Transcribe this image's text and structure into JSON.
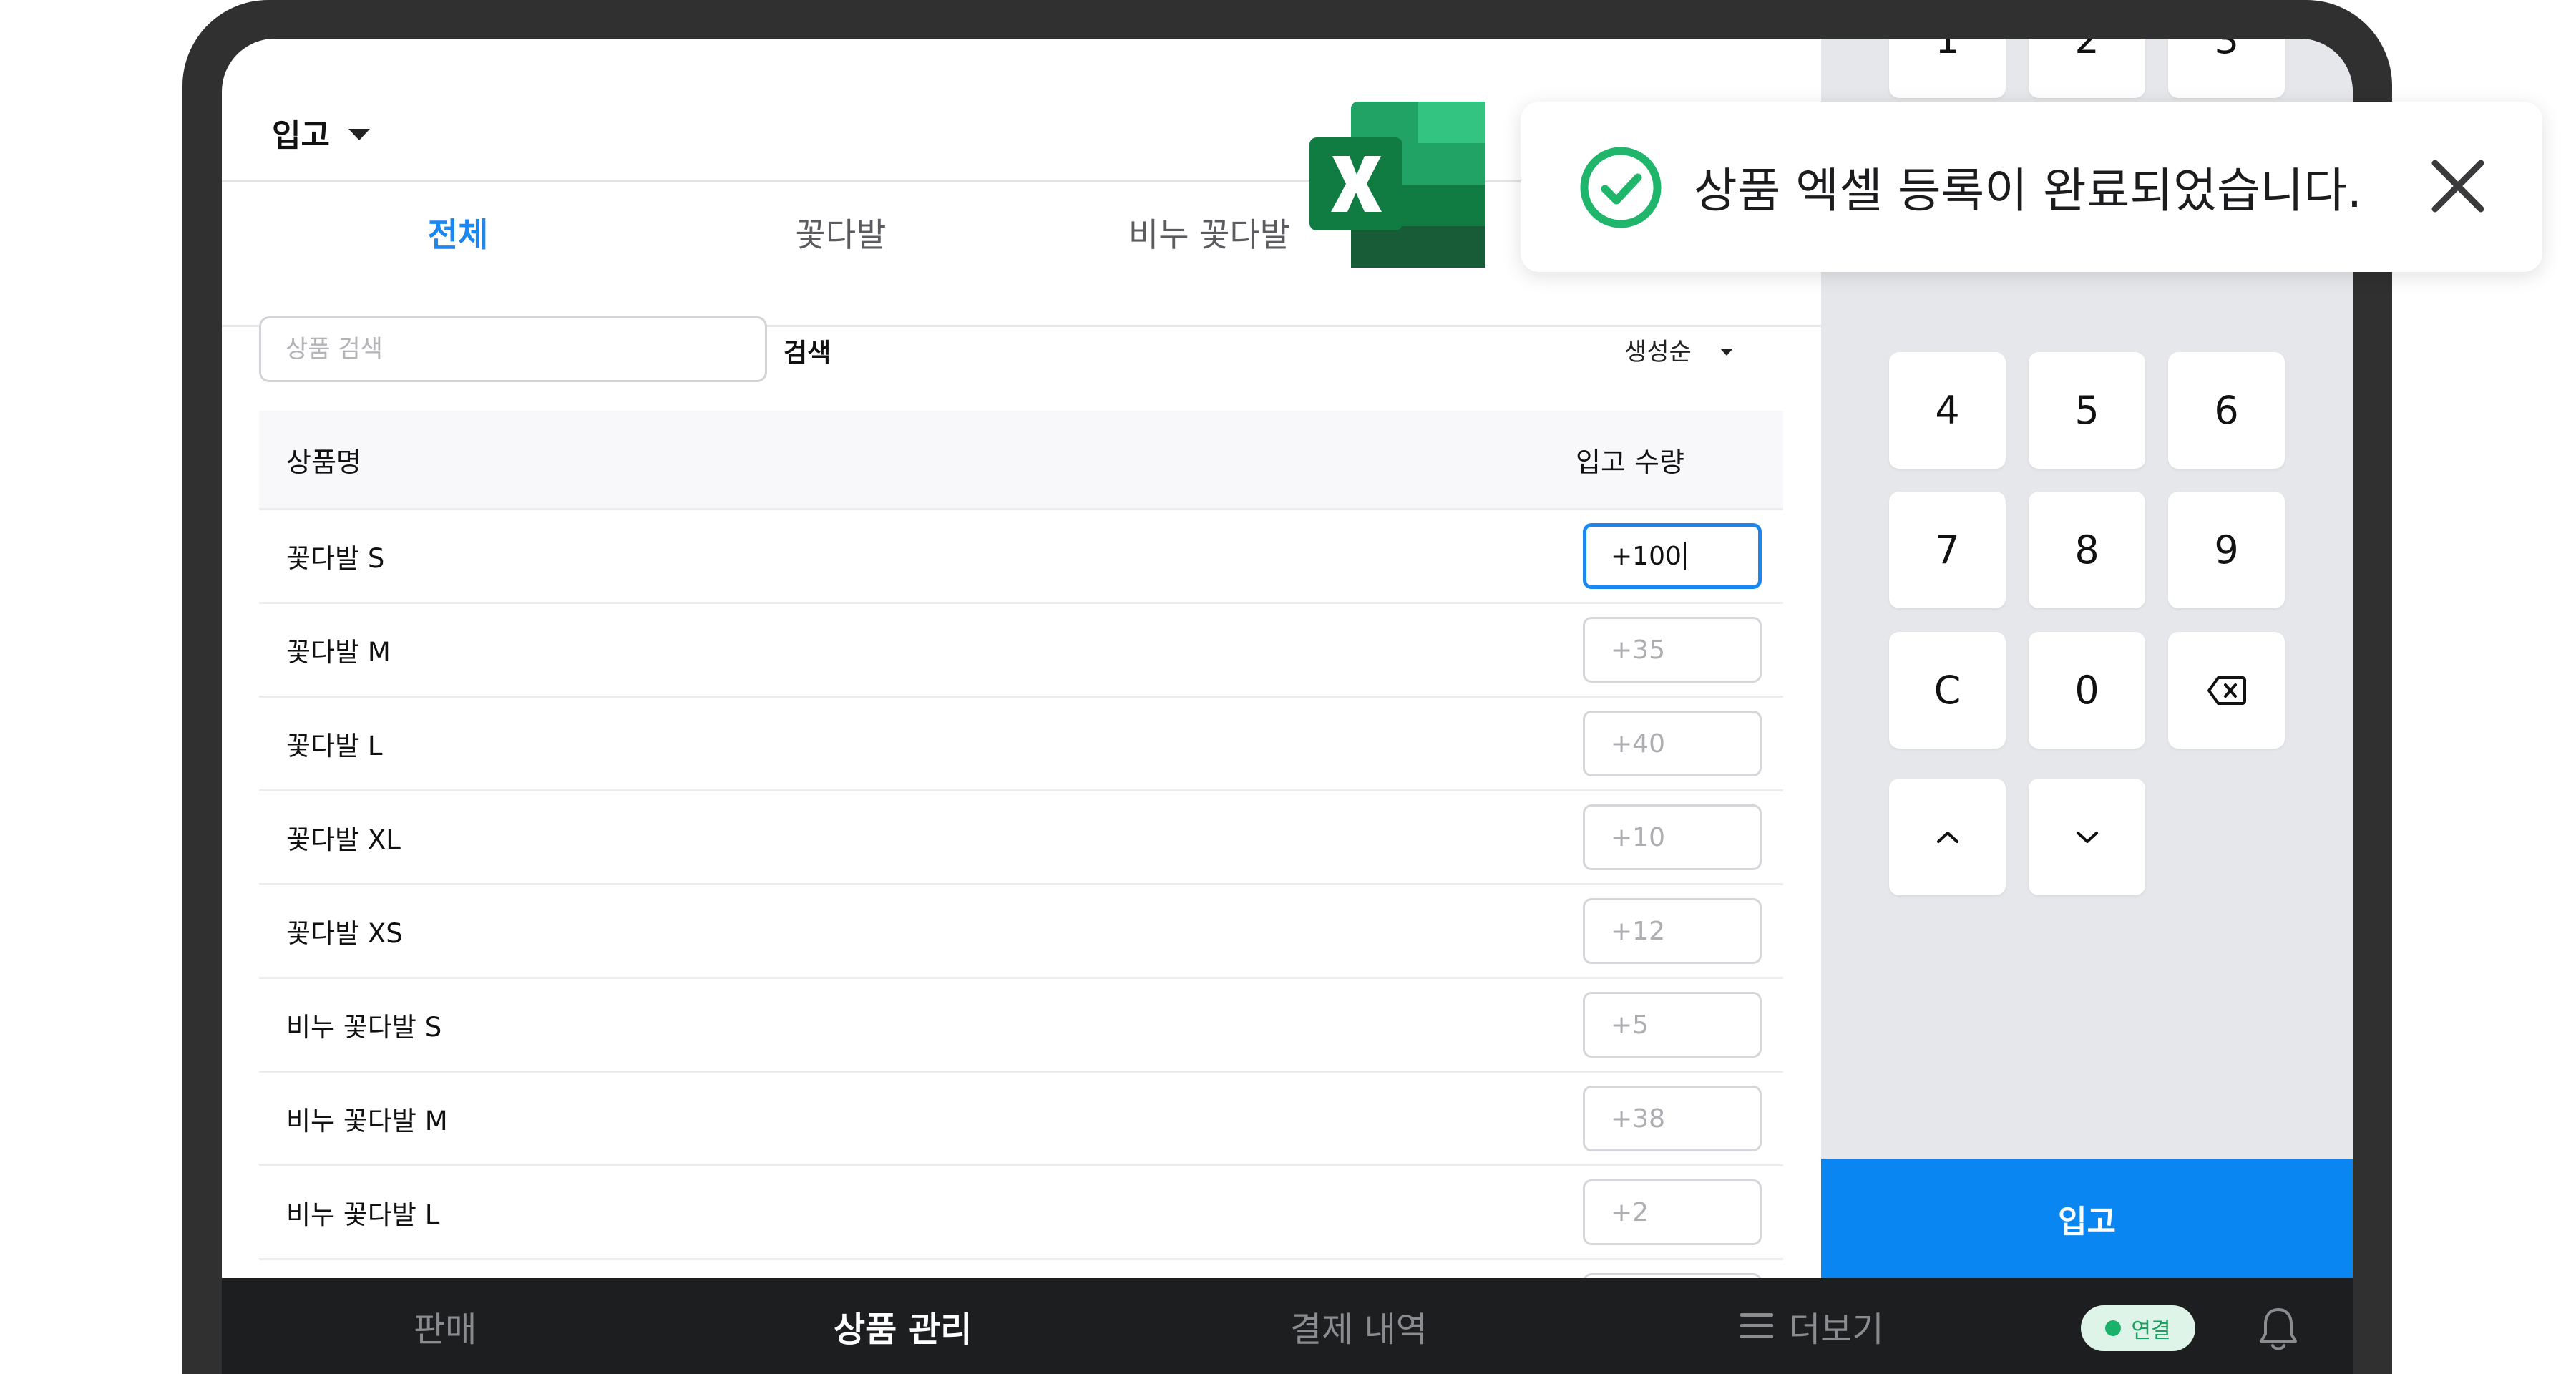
{
  "header": {
    "mode_label": "입고"
  },
  "tabs": [
    {
      "label": "전체",
      "active": true
    },
    {
      "label": "꽃다발",
      "active": false
    },
    {
      "label": "비누 꽃다발",
      "active": false
    }
  ],
  "search": {
    "placeholder": "상품 검색",
    "button_label": "검색",
    "sort_label": "생성순"
  },
  "table": {
    "headers": {
      "name": "상품명",
      "qty": "입고 수량"
    },
    "rows": [
      {
        "name": "꽃다발 S",
        "qty": "+100",
        "active": true
      },
      {
        "name": "꽃다발 M",
        "qty": "+35"
      },
      {
        "name": "꽃다발 L",
        "qty": "+40"
      },
      {
        "name": "꽃다발 XL",
        "qty": "+10"
      },
      {
        "name": "꽃다발 XS",
        "qty": "+12"
      },
      {
        "name": "비누 꽃다발 S",
        "qty": "+5"
      },
      {
        "name": "비누 꽃다발 M",
        "qty": "+38"
      },
      {
        "name": "비누 꽃다발 L",
        "qty": "+2"
      }
    ]
  },
  "keypad": {
    "keys": [
      "1",
      "2",
      "3",
      "4",
      "5",
      "6",
      "7",
      "8",
      "9",
      "C",
      "0"
    ],
    "backspace_icon": "backspace-icon",
    "up_icon": "chevron-up-icon",
    "down_icon": "chevron-down-icon"
  },
  "submit_label": "입고",
  "nav": {
    "sale": "판매",
    "products": "상품 관리",
    "payments": "결제 내역",
    "more": "더보기",
    "connection": "연결"
  },
  "toast": {
    "message": "상품 엑셀 등록이 완료되었습니다."
  },
  "colors": {
    "accent": "#1a88f0",
    "submit": "#0a86f2",
    "success": "#1fb56b",
    "excel_green": "#1d6f42"
  }
}
